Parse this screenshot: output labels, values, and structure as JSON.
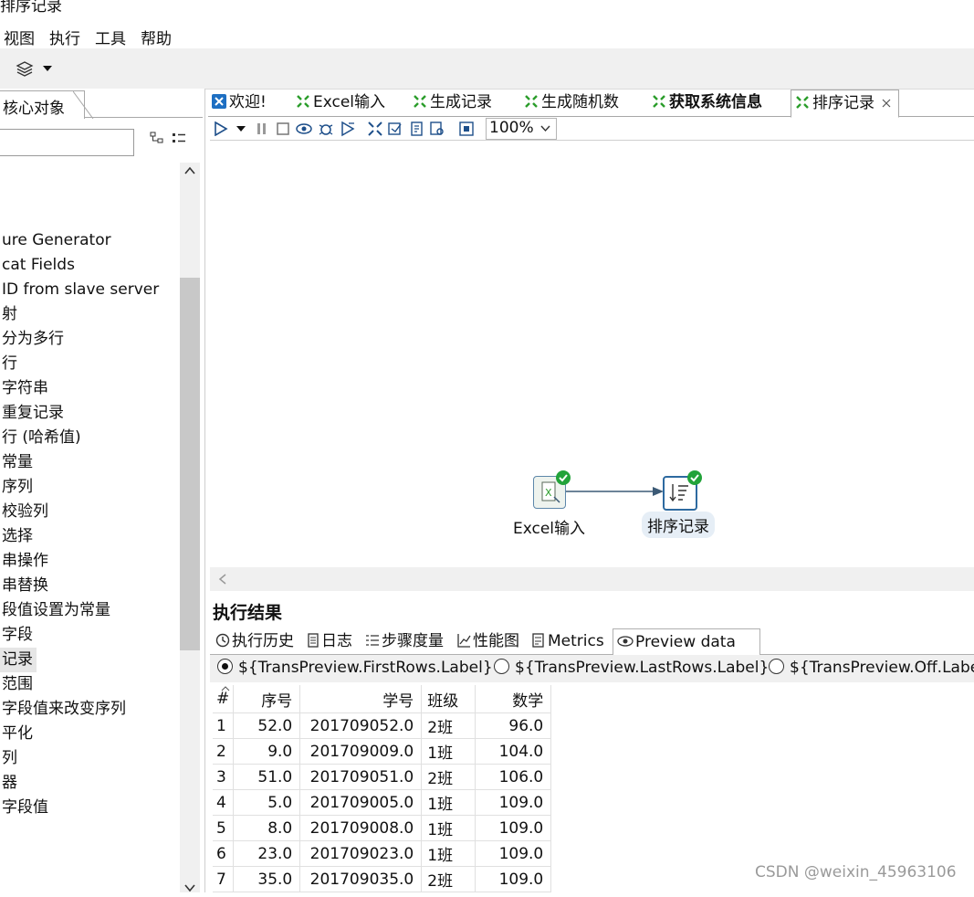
{
  "window": {
    "title": "排序记录"
  },
  "menu": {
    "items": [
      "视图",
      "执行",
      "工具",
      "帮助"
    ]
  },
  "left_panel": {
    "tab_label": "核心对象",
    "steps": [
      "ure Generator",
      "cat Fields",
      "ID from slave server",
      "射",
      "分为多行",
      "行",
      "字符串",
      "重复记录",
      "行 (哈希值)",
      "常量",
      "序列",
      "校验列",
      "选择",
      "串操作",
      "串替换",
      "段值设置为常量",
      "字段",
      "记录",
      "范围",
      "字段值来改变序列",
      "平化",
      "列",
      "器",
      "字段值"
    ],
    "selected_index": 17
  },
  "editor_tabs": [
    {
      "label": "欢迎!",
      "icon": "welcome-icon",
      "bold": false
    },
    {
      "label": "Excel输入",
      "icon": "transformation-icon",
      "bold": false
    },
    {
      "label": "生成记录",
      "icon": "transformation-icon",
      "bold": false
    },
    {
      "label": "生成随机数",
      "icon": "transformation-icon",
      "bold": false
    },
    {
      "label": "获取系统信息",
      "icon": "transformation-icon",
      "bold": true
    },
    {
      "label": "排序记录",
      "icon": "transformation-icon",
      "bold": false,
      "active": true
    }
  ],
  "canvas_toolbar": {
    "zoom": "100%"
  },
  "canvas": {
    "nodes": [
      {
        "label": "Excel输入",
        "icon": "excel-input-icon",
        "status": "ok"
      },
      {
        "label": "排序记录",
        "icon": "sort-rows-icon",
        "status": "ok",
        "selected": true
      }
    ]
  },
  "results": {
    "title": "执行结果",
    "tabs": [
      "执行历史",
      "日志",
      "步骤度量",
      "性能图",
      "Metrics",
      "Preview data"
    ],
    "active_tab": "Preview data",
    "radio_options": [
      {
        "label": "${TransPreview.FirstRows.Label}",
        "checked": true
      },
      {
        "label": "${TransPreview.LastRows.Label}",
        "checked": false
      },
      {
        "label": "${TransPreview.Off.Labe",
        "checked": false
      }
    ],
    "table": {
      "headers": [
        "#",
        "序号",
        "学号",
        "班级",
        "数学"
      ],
      "rows": [
        [
          "1",
          "52.0",
          "201709052.0",
          "2班",
          "96.0"
        ],
        [
          "2",
          "9.0",
          "201709009.0",
          "1班",
          "104.0"
        ],
        [
          "3",
          "51.0",
          "201709051.0",
          "2班",
          "106.0"
        ],
        [
          "4",
          "5.0",
          "201709005.0",
          "1班",
          "109.0"
        ],
        [
          "5",
          "8.0",
          "201709008.0",
          "1班",
          "109.0"
        ],
        [
          "6",
          "23.0",
          "201709023.0",
          "1班",
          "109.0"
        ],
        [
          "7",
          "35.0",
          "201709035.0",
          "2班",
          "109.0"
        ]
      ]
    }
  },
  "watermark": "CSDN @weixin_45963106",
  "colors": {
    "accent_green": "#2a9d2a",
    "selection_blue": "#2d6aa0",
    "status_ok": "#22a33a"
  }
}
